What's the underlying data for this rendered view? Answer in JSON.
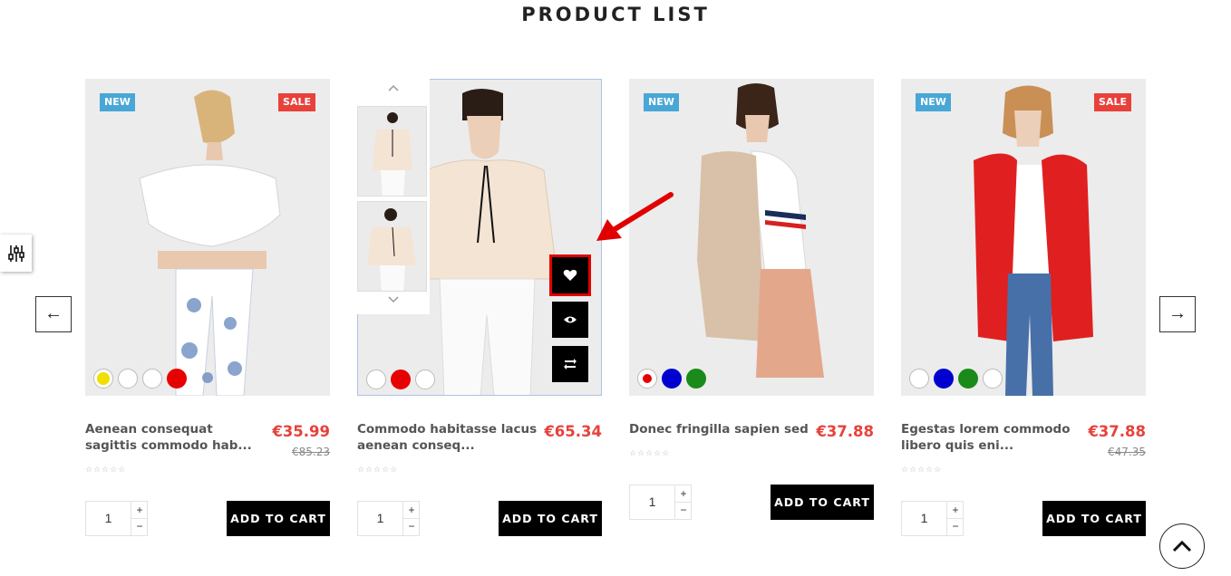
{
  "section_title": "PRODUCT LIST",
  "badges": {
    "new": "NEW",
    "sale": "SALE"
  },
  "cart_label": "ADD TO CART",
  "products": [
    {
      "name": "Aenean consequat sagittis commodo hab...",
      "price": "€35.99",
      "old_price": "€85.23",
      "qty": "1",
      "badges": [
        "NEW",
        "SALE"
      ],
      "swatches": [
        "#f0e000",
        "#ffffff",
        "#ffffff",
        "#e80000"
      ],
      "rating": 0
    },
    {
      "name": "Commodo habitasse lacus aenean conseq...",
      "price": "€65.34",
      "old_price": "",
      "qty": "1",
      "badges": [],
      "swatches": [
        "#ffffff",
        "#e80000",
        "#ffffff"
      ],
      "rating": 0
    },
    {
      "name": "Donec fringilla sapien sed",
      "price": "€37.88",
      "old_price": "",
      "qty": "1",
      "badges": [
        "NEW"
      ],
      "swatches": [
        "#e80000",
        "#0000d0",
        "#1a8a1a"
      ],
      "rating": 0
    },
    {
      "name": "Egestas lorem commodo libero quis eni...",
      "price": "€37.88",
      "old_price": "€47.35",
      "qty": "1",
      "badges": [
        "NEW",
        "SALE"
      ],
      "swatches": [
        "#ffffff",
        "#0000d0",
        "#1a8a1a",
        "#ffffff"
      ],
      "rating": 0
    }
  ],
  "icons": {
    "wishlist": "heart-icon",
    "quick_view": "eye-icon",
    "compare": "compare-icon",
    "prev": "arrow-left-icon",
    "next": "arrow-right-icon",
    "scroll_top": "chevron-up-icon",
    "side_tool": "sliders-icon"
  },
  "colors": {
    "price": "#e8413b",
    "new_badge": "#48a7d6",
    "sale_badge": "#e8413b",
    "highlight": "#e00000"
  }
}
